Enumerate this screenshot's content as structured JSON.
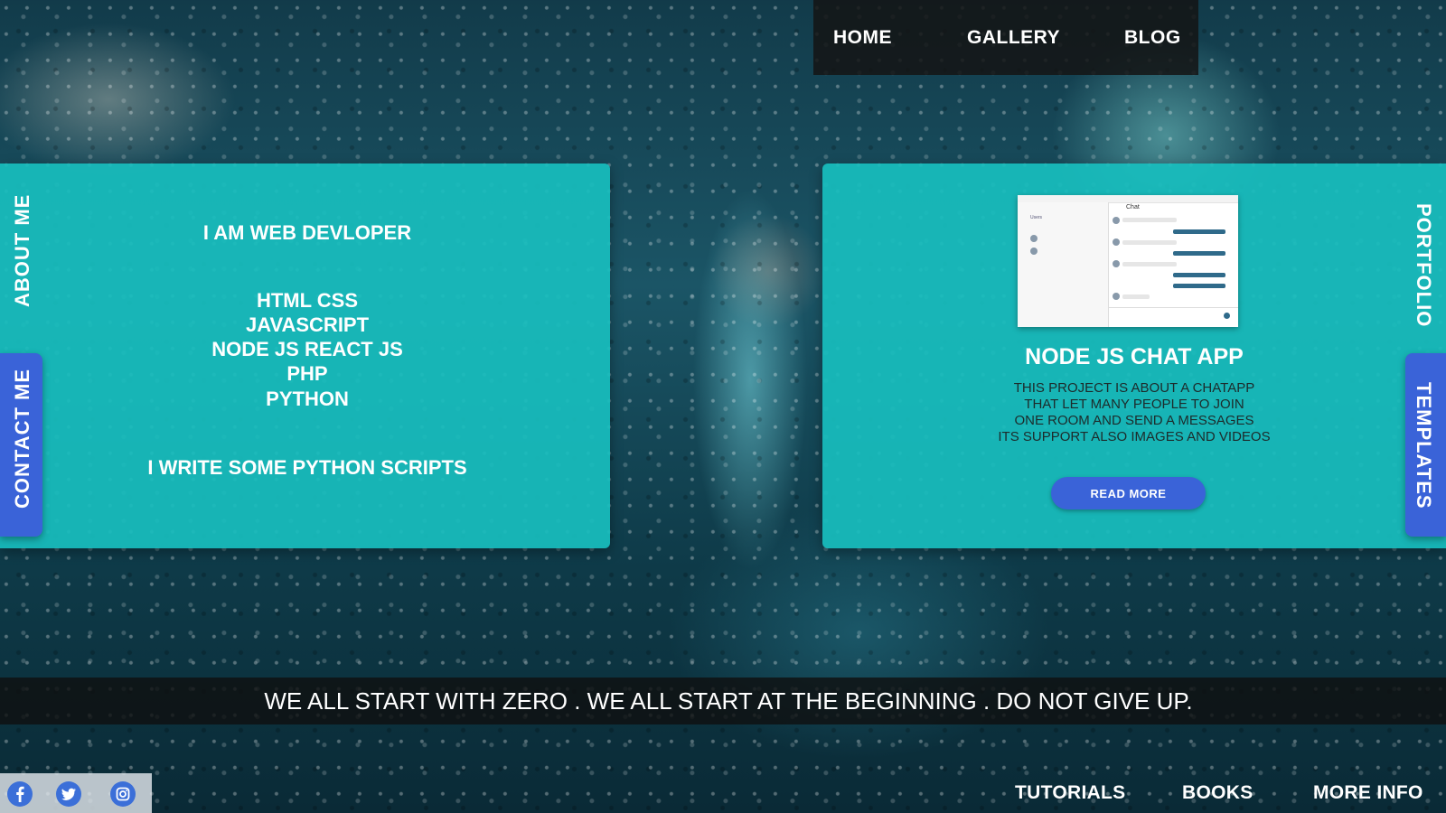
{
  "nav": {
    "home": "HOME",
    "gallery": "GALLERY",
    "blog": "BLOG"
  },
  "about": {
    "side_label": "ABOUT ME",
    "intro": "I AM WEB DEVLOPER",
    "skills": [
      "HTML CSS",
      "JAVASCRIPT",
      "NODE JS REACT JS",
      "PHP",
      "PYTHON"
    ],
    "outro": "I WRITE SOME PYTHON SCRIPTS"
  },
  "contact_tab": "CONTACT ME",
  "portfolio": {
    "side_label": "PORTFOLIO",
    "templates_tab": "TEMPLATES",
    "project_title": "NODE JS CHAT APP",
    "description": [
      "THIS PROJECT IS ABOUT A CHATAPP",
      "THAT LET MANY PEOPLE TO JOIN",
      "ONE ROOM AND SEND A MESSAGES",
      "ITS SUPPORT ALSO IMAGES AND VIDEOS"
    ],
    "read_more": "READ MORE",
    "screenshot": {
      "title": "Chat",
      "users_label": "Users"
    }
  },
  "quote": "WE ALL START WITH ZERO . WE ALL START AT THE BEGINNING . DO NOT GIVE UP.",
  "social": [
    "facebook-icon",
    "twitter-icon",
    "instagram-icon"
  ],
  "footer": {
    "tutorials": "TUTORIALS",
    "books": "BOOKS",
    "more_info": "MORE INFO"
  },
  "colors": {
    "panel": "#18bebe",
    "accent_button": "#3a63d8",
    "nav_bg": "#141414"
  }
}
